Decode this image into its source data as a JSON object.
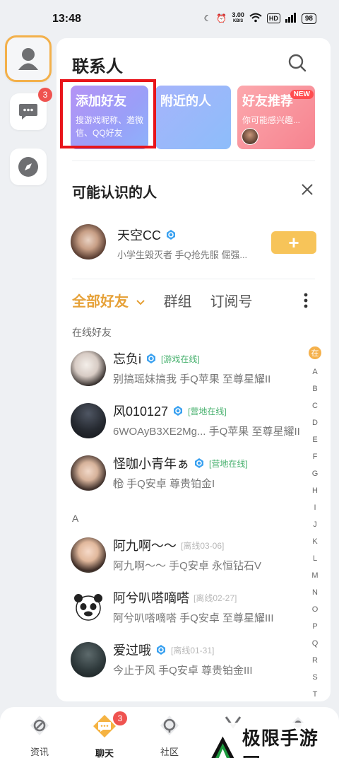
{
  "status_bar": {
    "time": "13:48",
    "net_speed": "3.00",
    "net_unit": "KB/S",
    "hd_label": "HD",
    "battery": "98"
  },
  "rail": {
    "chat_badge": "3"
  },
  "header": {
    "title": "联系人"
  },
  "cards": [
    {
      "title": "添加好友",
      "desc": "搜游戏昵称、邀微信、QQ好友"
    },
    {
      "title": "附近的人",
      "desc": ""
    },
    {
      "title": "好友推荐",
      "desc": "你可能感兴趣...",
      "badge": "NEW"
    }
  ],
  "recommend": {
    "title": "可能认识的人",
    "person": {
      "name": "天空CC",
      "sub": "小学生毁灭者 手Q抢先服 倔强..."
    },
    "add_label": "+"
  },
  "tabs": {
    "all": "全部好友",
    "groups": "群组",
    "subs": "订阅号"
  },
  "groups": {
    "online": "在线好友",
    "a": "A"
  },
  "friends_online": [
    {
      "name": "忘负i",
      "status": "[游戏在线]",
      "sub": "别搞瑶妹搞我   手Q苹果   至尊星耀II"
    },
    {
      "name": "风010127",
      "status": "[营地在线]",
      "sub": "6WOAyB3XE2Mg...   手Q苹果   至尊星耀II"
    },
    {
      "name": "怪咖小青年ぁ",
      "status": "[营地在线]",
      "sub": "枪⃝   手Q安卓   尊贵铂金I"
    }
  ],
  "friends_a": [
    {
      "name": "阿九啊～～",
      "status": "[离线03-06]",
      "sub": "阿九啊～～   手Q安卓   永恒钻石V"
    },
    {
      "name": "阿兮叭嗒嘀嗒",
      "status": "[离线02-27]",
      "sub": "阿兮叭嗒嘀嗒   手Q安卓   至尊星耀III"
    },
    {
      "name": "爱过哦",
      "status": "[离线01-31]",
      "sub": "今止于风   手Q安卓   尊贵铂金III"
    }
  ],
  "alpha_index": {
    "current": "在",
    "letters": [
      "A",
      "B",
      "C",
      "D",
      "E",
      "F",
      "G",
      "H",
      "I",
      "J",
      "K",
      "L",
      "M",
      "N",
      "O",
      "P",
      "Q",
      "R",
      "S",
      "T"
    ]
  },
  "bottom_nav": {
    "news": "资讯",
    "chat": "聊天",
    "community": "社区",
    "chat_badge": "3"
  },
  "watermark": {
    "text": "极限手游网"
  },
  "colors": {
    "accent": "#e6a138",
    "online": "#46b06d",
    "badge": "#ef5350",
    "highlight": "#e8151b"
  }
}
